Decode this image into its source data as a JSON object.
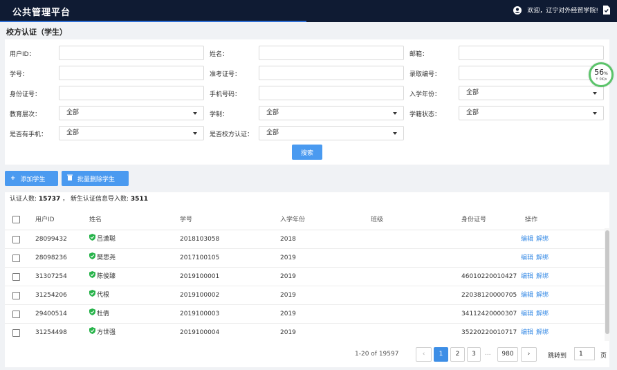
{
  "header": {
    "app_title": "公共管理平台",
    "welcome_text": "欢迎，辽宁对外经贸学院!",
    "user_icon": "user-icon",
    "logout_icon": "logout-icon"
  },
  "page": {
    "title": "校方认证（学生）"
  },
  "filters": {
    "user_id_label": "用户ID：",
    "name_label": "姓名：",
    "email_label": "邮箱：",
    "student_no_label": "学号：",
    "exam_no_label": "准考证号：",
    "admission_no_label": "录取编号：",
    "id_card_label": "身份证号：",
    "phone_label": "手机号码：",
    "enroll_year_label": "入学年份：",
    "enroll_year_value": "全部",
    "edu_level_label": "教育层次：",
    "edu_level_value": "全部",
    "schooling_label": "学制：",
    "schooling_value": "全部",
    "status_label": "学籍状态：",
    "status_value": "全部",
    "has_phone_label": "是否有手机：",
    "has_phone_value": "全部",
    "verified_label": "是否校方认证：",
    "verified_value": "全部",
    "search_button": "搜索"
  },
  "speed_widget": {
    "percent": "56",
    "percent_unit": "%",
    "rate": "↑ 0K/s"
  },
  "actions": {
    "add_label": "添加学生",
    "batch_delete_label": "批量删除学生",
    "add_icon": "plus-icon",
    "batch_delete_icon": "trash-icon"
  },
  "summary": {
    "verified_count_label": "认证人数:",
    "verified_count": "15737",
    "separator": "，",
    "import_count_label": "新生认证信息导入数:",
    "import_count": "3511"
  },
  "table": {
    "columns": [
      "用户ID",
      "姓名",
      "学号",
      "入学年份",
      "班级",
      "身份证号",
      "操作"
    ],
    "rows": [
      {
        "user_id": "28099432",
        "name": "吕潇聪",
        "student_no": "2018103058",
        "year": "2018",
        "class": "",
        "id_card": "",
        "edit": "编辑",
        "unbind": "解绑"
      },
      {
        "user_id": "28098236",
        "name": "樊思尧",
        "student_no": "2017100105",
        "year": "2019",
        "class": "",
        "id_card": "",
        "edit": "编辑",
        "unbind": "解绑"
      },
      {
        "user_id": "31307254",
        "name": "陈俊臻",
        "student_no": "2019100001",
        "year": "2019",
        "class": "",
        "id_card": "46010220010427",
        "edit": "编辑",
        "unbind": "解绑"
      },
      {
        "user_id": "31254206",
        "name": "代根",
        "student_no": "2019100002",
        "year": "2019",
        "class": "",
        "id_card": "22038120000705",
        "edit": "编辑",
        "unbind": "解绑"
      },
      {
        "user_id": "29400514",
        "name": "杜倩",
        "student_no": "2019100003",
        "year": "2019",
        "class": "",
        "id_card": "34112420000307",
        "edit": "编辑",
        "unbind": "解绑"
      },
      {
        "user_id": "31254498",
        "name": "方世强",
        "student_no": "2019100004",
        "year": "2019",
        "class": "",
        "id_card": "35220220010717",
        "edit": "编辑",
        "unbind": "解绑"
      }
    ]
  },
  "pagination": {
    "total_text": "1-20 of 19597",
    "prev_icon": "chevron-left-icon",
    "next_icon": "chevron-right-icon",
    "pages": [
      "1",
      "2",
      "3"
    ],
    "ellipsis": "...",
    "last_page": "980",
    "jump_label": "跳转到",
    "jump_value": "1",
    "page_unit": "页"
  },
  "colors": {
    "topbar": "#0f1b33",
    "accent": "#4a9af0",
    "link": "#3d8ee6",
    "verified": "#27b34a",
    "speed_ring": "#5bc46a"
  }
}
